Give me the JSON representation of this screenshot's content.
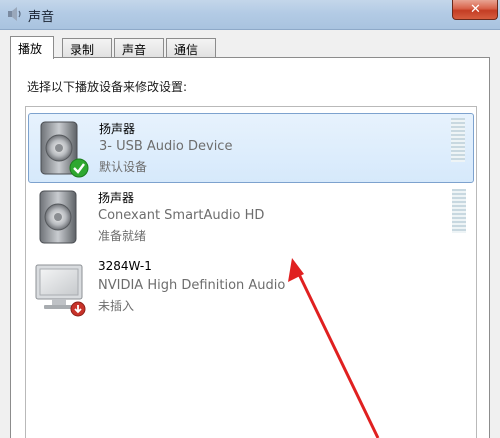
{
  "window": {
    "title": "声音"
  },
  "tabs": [
    {
      "label": "播放",
      "active": true
    },
    {
      "label": "录制",
      "active": false
    },
    {
      "label": "声音",
      "active": false
    },
    {
      "label": "通信",
      "active": false
    }
  ],
  "instruction": "选择以下播放设备来修改设置:",
  "devices": [
    {
      "name": "扬声器",
      "description": "3- USB Audio Device",
      "status": "默认设备",
      "icon": "speaker-icon",
      "badge": "default-check-icon",
      "selected": true
    },
    {
      "name": "扬声器",
      "description": "Conexant SmartAudio HD",
      "status": "准备就绪",
      "icon": "speaker-icon",
      "badge": null,
      "selected": false
    },
    {
      "name": "3284W-1",
      "description": "NVIDIA High Definition Audio",
      "status": "未插入",
      "icon": "monitor-icon",
      "badge": "unplugged-icon",
      "selected": false
    }
  ],
  "colors": {
    "selection": "#d6e9fb",
    "check": "#2fa830",
    "unplugged": "#c8332a",
    "annotation_arrow": "#e02020"
  }
}
